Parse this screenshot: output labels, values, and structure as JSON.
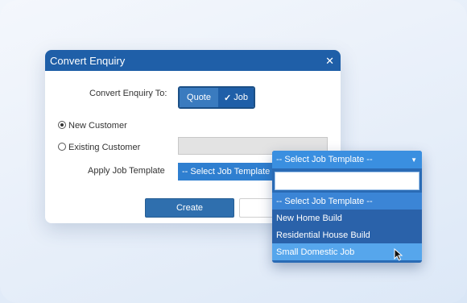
{
  "dialog": {
    "title": "Convert Enquiry",
    "close_glyph": "✕",
    "convert_label": "Convert Enquiry To:",
    "toggle": {
      "quote_label": "Quote",
      "job_label": "Job",
      "selected": "Job"
    },
    "new_customer_label": "New Customer",
    "existing_customer_label": "Existing Customer",
    "selected_customer_option": "New Customer",
    "apply_template_label": "Apply Job Template",
    "template_value": "-- Select Job Template --",
    "create_label": "Create"
  },
  "dropdown": {
    "selected": "-- Select Job Template --",
    "search_value": "",
    "options": [
      "-- Select Job Template --",
      "New Home Build",
      "Residential House Build",
      "Small Domestic Job"
    ],
    "hovered_option": "Small Domestic Job"
  },
  "colors": {
    "header": "#1f5fa8",
    "accent": "#2f7fd0",
    "dropdown_bg": "#2a6bb5"
  }
}
